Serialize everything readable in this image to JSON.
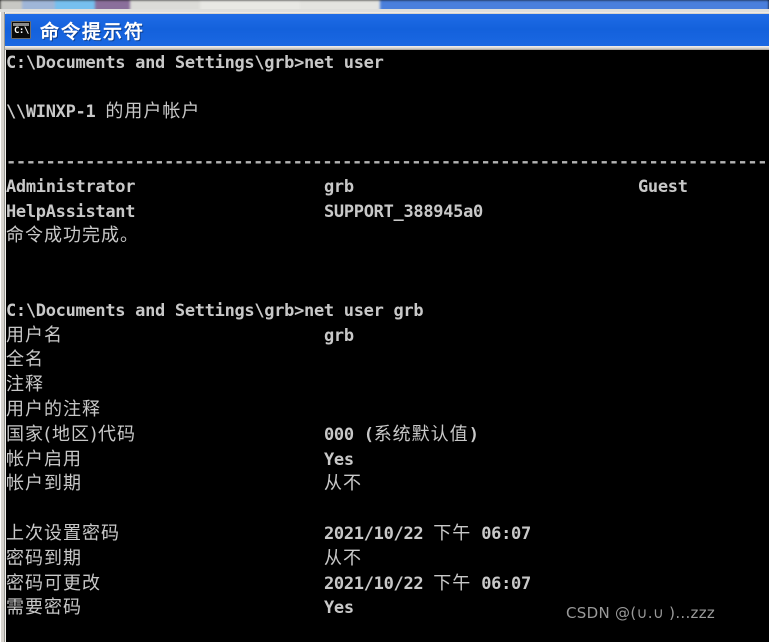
{
  "window": {
    "title": "命令提示符",
    "icon": "console-icon",
    "icon_text": "C:\\",
    "titlebar_color": "#1565e0",
    "background_color": "#000000",
    "text_color": "#c8c8c8"
  },
  "console": {
    "lines": [
      {
        "type": "blank",
        "text": ""
      },
      {
        "type": "ascii",
        "text": "C:\\Documents and Settings\\grb>net user"
      },
      {
        "type": "blank",
        "text": ""
      },
      {
        "type": "mixed",
        "col0": "\\\\WINXP-1 的用户帐户"
      },
      {
        "type": "blank",
        "text": ""
      },
      {
        "type": "dashes",
        "text": "-------------------------------------------------------------------------------"
      },
      {
        "type": "cols",
        "col0": "Administrator",
        "col26": "grb",
        "col52": "Guest"
      },
      {
        "type": "cols",
        "col0": "HelpAssistant",
        "col26": "SUPPORT_388945a0",
        "col52": ""
      },
      {
        "type": "cjk",
        "col0": "命令成功完成。"
      },
      {
        "type": "blank",
        "text": ""
      },
      {
        "type": "blank",
        "text": ""
      },
      {
        "type": "ascii",
        "text": "C:\\Documents and Settings\\grb>net user grb"
      },
      {
        "type": "cjkval",
        "col0": "用户名",
        "col26": "grb"
      },
      {
        "type": "cjkval",
        "col0": "全名",
        "col26": ""
      },
      {
        "type": "cjkval",
        "col0": "注释",
        "col26": ""
      },
      {
        "type": "cjkval",
        "col0": "用户的注释",
        "col26": ""
      },
      {
        "type": "cjkval",
        "col0": "国家(地区)代码",
        "col26": "000 (系统默认值)"
      },
      {
        "type": "cjkval",
        "col0": "帐户启用",
        "col26": "Yes"
      },
      {
        "type": "cjkval",
        "col0": "帐户到期",
        "col26": "从不"
      },
      {
        "type": "blank",
        "text": ""
      },
      {
        "type": "cjkval",
        "col0": "上次设置密码",
        "col26": "2021/10/22 下午 06:07"
      },
      {
        "type": "cjkval",
        "col0": "密码到期",
        "col26": "从不"
      },
      {
        "type": "cjkval",
        "col0": "密码可更改",
        "col26": "2021/10/22 下午 06:07"
      },
      {
        "type": "cjkval",
        "col0": "需要密码",
        "col26": "Yes"
      }
    ]
  },
  "watermark": {
    "text": "CSDN @(∪.∪ )...zzz"
  }
}
